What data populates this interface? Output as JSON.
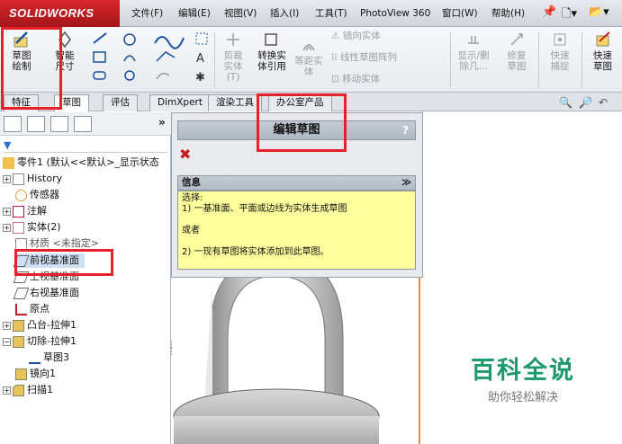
{
  "app": {
    "logo": "SOLIDWORKS"
  },
  "menu": [
    "文件(F)",
    "编辑(E)",
    "视图(V)",
    "插入(I)",
    "工具(T)",
    "PhotoView 360",
    "窗口(W)",
    "帮助(H)"
  ],
  "ribbon": {
    "sketch": "草图绘制",
    "smart_dim": "智能尺寸",
    "trim": "剪裁实体(T)",
    "convert": "转换实体引用",
    "offset": "等距实体",
    "mirror": "镜向实体",
    "linear_pattern": "线性草图阵列",
    "move": "移动实体",
    "display_delete": "显示/删除几...",
    "repair": "修复草图",
    "quick_snap": "快速捕捉",
    "quick_sketch": "快速草图"
  },
  "tabs": [
    "特征",
    "草图",
    "评估",
    "DimXpert",
    "渲染工具",
    "办公室产品"
  ],
  "tree": {
    "filter_icon": "filter-icon",
    "items": [
      {
        "label": "零件1 (默认<<默认>_显示状态"
      },
      {
        "label": "History"
      },
      {
        "label": "传感器"
      },
      {
        "label": "注解"
      },
      {
        "label": "实体(2)"
      },
      {
        "label": "材质 <未指定>"
      },
      {
        "label": "前视基准面"
      },
      {
        "label": "上视基准面"
      },
      {
        "label": "右视基准面"
      },
      {
        "label": "原点"
      },
      {
        "label": "凸台-拉伸1"
      },
      {
        "label": "切除-拉伸1"
      },
      {
        "label": "草图3"
      },
      {
        "label": "镜向1"
      },
      {
        "label": "扫描1"
      }
    ]
  },
  "property_manager": {
    "title": "编辑草图",
    "help": "?",
    "info_header": "信息",
    "info_lines": [
      "选择:",
      "1) 一基准面、平面或边线为实体生成草图",
      "或者",
      "2) 一现有草图将实体添加到此草图。"
    ]
  },
  "watermark": {
    "line1": "百科全说",
    "line2": "助你轻松解决"
  },
  "colors": {
    "highlight": "#e6212a",
    "info_bg": "#ffff9e",
    "logo_red": "#c41e24"
  }
}
